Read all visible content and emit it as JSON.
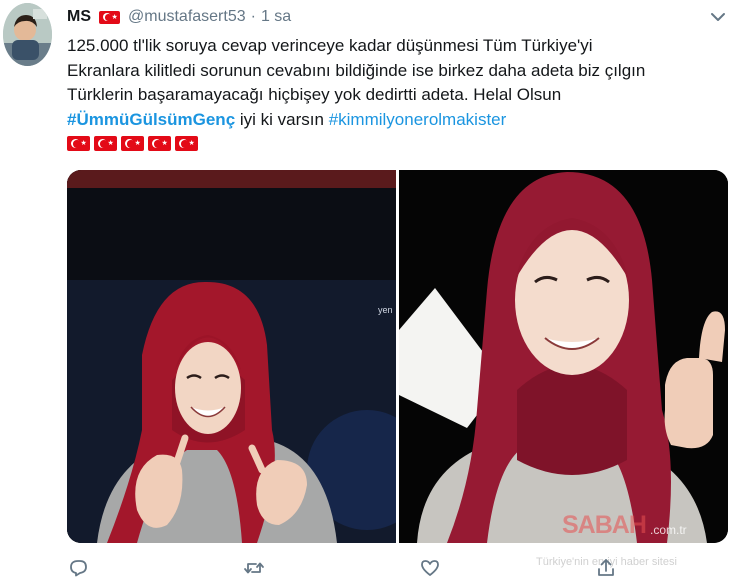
{
  "tweet": {
    "author_name": "MS",
    "handle": "@mustafasert53",
    "separator": "·",
    "time": "1 sa",
    "text_lines": [
      "125.000 tl'lik soruya cevap verinceye kadar düşünmesi Tüm Türkiye'yi",
      "Ekranlara kilitledi sorunun cevabını bildiğinde ise birkez daha adeta biz çılgın",
      "Türklerin başaramayacağı hiçbişey yok dedirtti adeta. Helal Olsun"
    ],
    "hashtag_1": "#ÜmmüGülsümGenç",
    "middle_text": " iyi ki varsın ",
    "hashtag_2": "#kimmilyonerolmakister",
    "flag_emoji_count": 5
  },
  "media": {
    "left_image": "contestant-photo-left",
    "right_image": "contestant-photo-right",
    "screen_text": "yen"
  },
  "watermark": {
    "brand": "SABAH",
    "domain": ".com.tr",
    "tagline": "Türkiye'nin en iyi haber sitesi"
  },
  "icons": {
    "reply": "reply-icon",
    "retweet": "retweet-icon",
    "like": "heart-icon",
    "share": "share-icon",
    "menu": "chevron-down-icon"
  },
  "colors": {
    "link": "#1b95e0",
    "text": "#14171a",
    "muted": "#657786",
    "flag_red": "#e30a17"
  }
}
